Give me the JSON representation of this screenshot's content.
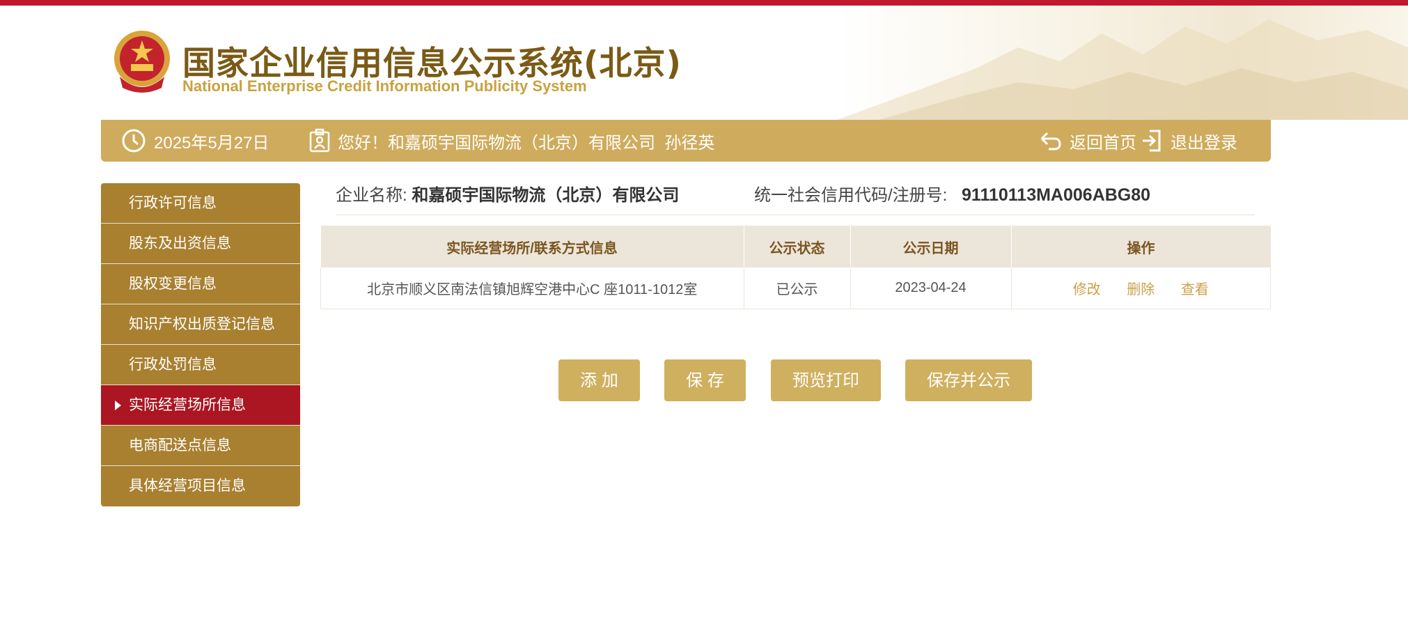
{
  "header": {
    "title": "国家企业信用信息公示系统(北京)",
    "subtitle": "National Enterprise Credit Information Publicity System"
  },
  "infobar": {
    "date": "2025年5月27日",
    "greeting": "您好！和嘉硕宇国际物流（北京）有限公司  孙径英",
    "home_label": "返回首页",
    "logout_label": "退出登录"
  },
  "sidebar": {
    "items": [
      {
        "label": "行政许可信息"
      },
      {
        "label": "股东及出资信息"
      },
      {
        "label": "股权变更信息"
      },
      {
        "label": "知识产权出质登记信息"
      },
      {
        "label": "行政处罚信息"
      },
      {
        "label": "实际经营场所信息",
        "active": true
      },
      {
        "label": "电商配送点信息"
      },
      {
        "label": "具体经营项目信息"
      }
    ]
  },
  "company": {
    "name_label": "企业名称:",
    "name": "和嘉硕宇国际物流（北京）有限公司",
    "code_label": "统一社会信用代码/注册号:",
    "code": "91110113MA006ABG80"
  },
  "table": {
    "headers": [
      "实际经营场所/联系方式信息",
      "公示状态",
      "公示日期",
      "操作"
    ],
    "rows": [
      {
        "address": "北京市顺义区南法信镇旭辉空港中心C 座1011-1012室",
        "status": "已公示",
        "date": "2023-04-24",
        "ops": [
          "修改",
          "删除",
          "查看"
        ]
      }
    ]
  },
  "buttons": {
    "add": "添 加",
    "save": "保 存",
    "preview_print": "预览打印",
    "save_publish": "保存并公示"
  },
  "colors": {
    "top_strip": "#c1182d",
    "bar_gold": "#cfab5d",
    "sidebar_gold": "#a88030",
    "sidebar_active": "#ab1622",
    "button_gold": "#cfb05f",
    "link_gold": "#c9a14e"
  },
  "icons": {
    "clock": "clock-icon",
    "user": "user-card-icon",
    "home": "return-arrow-icon",
    "logout": "logout-icon",
    "emblem": "national-emblem-icon"
  }
}
